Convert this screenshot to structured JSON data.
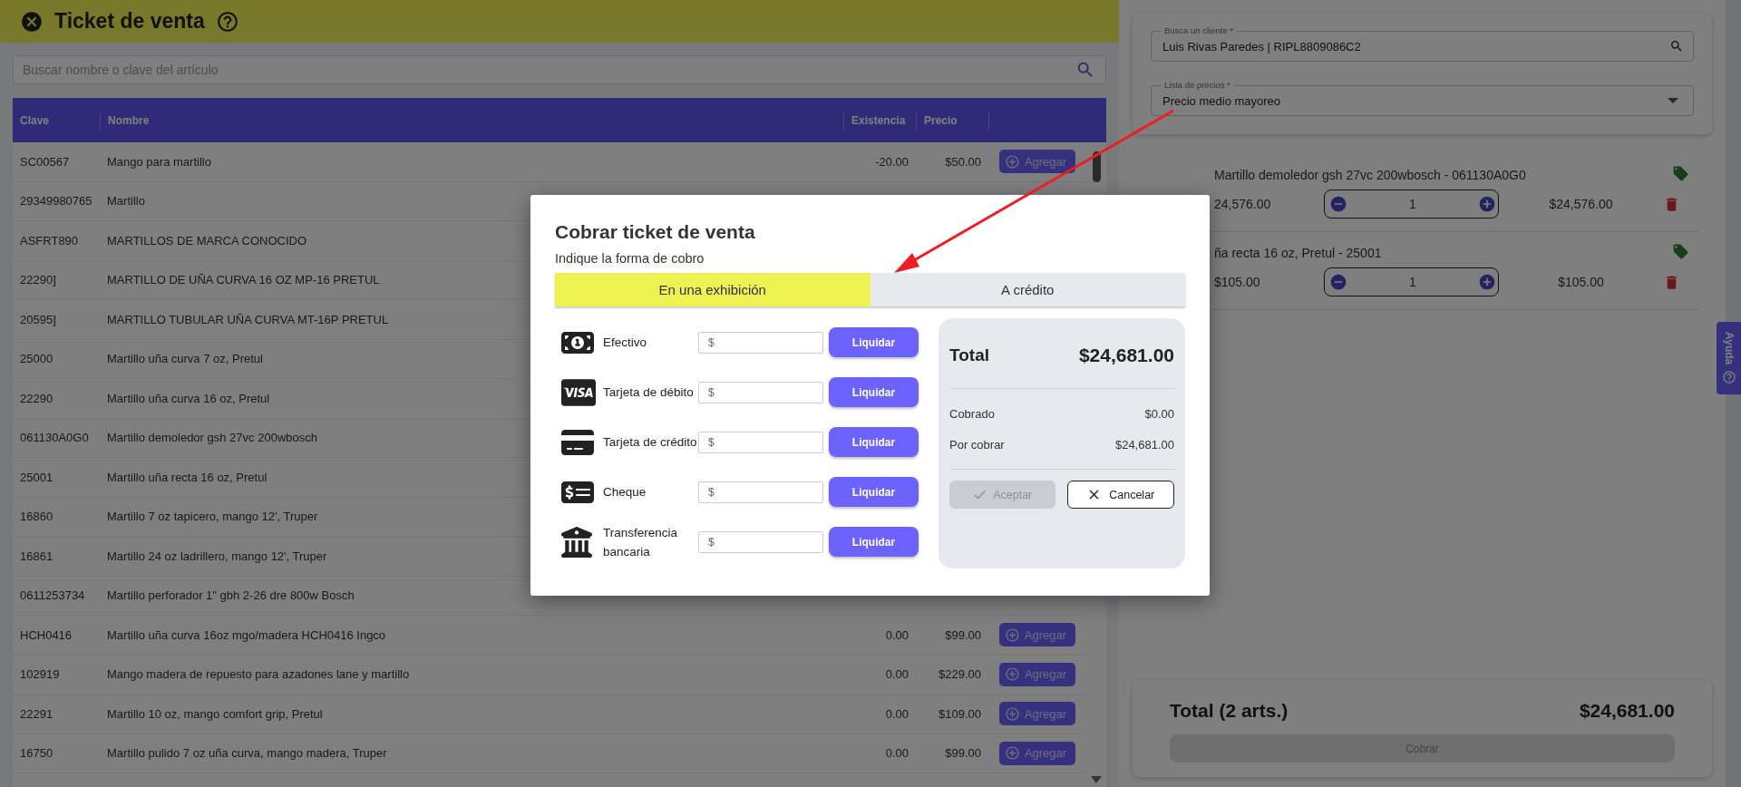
{
  "header": {
    "title": "Ticket de venta"
  },
  "search": {
    "placeholder": "Buscar nombre o clave del artículo"
  },
  "table": {
    "columns": [
      "Clave",
      "Nombre",
      "Existencia",
      "Precio"
    ],
    "rows": [
      {
        "clave": "SC00567",
        "nombre": "Mango para martillo",
        "existencia": "-20.00",
        "precio": "$50.00",
        "action": "Agregar"
      },
      {
        "clave": "29349980765",
        "nombre": "Martillo"
      },
      {
        "clave": "ASFRT890",
        "nombre": "MARTILLOS DE MARCA CONOCIDO"
      },
      {
        "clave": "22290]",
        "nombre": "MARTILLO DE UÑA CURVA 16 OZ MP-16 PRETUL"
      },
      {
        "clave": "20595]",
        "nombre": "MARTILLO TUBULAR UÑA CURVA MT-16P PRETUL"
      },
      {
        "clave": "25000",
        "nombre": "Martillo uña curva 7 oz, Pretul"
      },
      {
        "clave": "22290",
        "nombre": "Martillo uña curva 16 oz, Pretul"
      },
      {
        "clave": "061130A0G0",
        "nombre": "Martillo demoledor gsh 27vc 200wbosch"
      },
      {
        "clave": "25001",
        "nombre": "Martillo uña recta 16 oz, Pretul"
      },
      {
        "clave": "16860",
        "nombre": "Martillo 7 oz tapicero, mango 12', Truper"
      },
      {
        "clave": "16861",
        "nombre": "Martillo 24 oz ladrillero, mango 12', Truper"
      },
      {
        "clave": "0611253734",
        "nombre": "Martillo perforador 1\" gbh 2-26 dre 800w Bosch"
      },
      {
        "clave": "HCH0416",
        "nombre": "Martillo uña curva 16oz mgo/madera HCH0416 Ingco",
        "existencia": "0.00",
        "precio": "$99.00",
        "action": "Agregar"
      },
      {
        "clave": "102919",
        "nombre": "Mango madera de repuesto para azadones lane y martillo",
        "existencia": "0.00",
        "precio": "$229.00",
        "action": "Agregar"
      },
      {
        "clave": "22291",
        "nombre": "Martillo 10 oz, mango comfort grip, Pretul",
        "existencia": "0.00",
        "precio": "$109.00",
        "action": "Agregar"
      },
      {
        "clave": "16750",
        "nombre": "Martillo pulido 7 oz uña curva, mango madera, Truper",
        "existencia": "0.00",
        "precio": "$99.00",
        "action": "Agregar"
      }
    ]
  },
  "client_search": {
    "label": "Busca un cliente *",
    "value": "Luis Rivas Paredes | RIPL8809086C2"
  },
  "price_list": {
    "label": "Lista de precios *",
    "value": "Precio medio mayoreo"
  },
  "cart": [
    {
      "name": "Martillo demoledor gsh 27vc 200wbosch - 061130A0G0",
      "unit_price": "24,576.00",
      "quantity": "1",
      "line_total": "$24,576.00"
    },
    {
      "name": "ña recta 16 oz, Pretul - 25001",
      "unit_price": "$105.00",
      "quantity": "1",
      "line_total": "$105.00"
    }
  ],
  "help_tab": {
    "label": "Ayuda"
  },
  "footer": {
    "label": "Total (2 arts.)",
    "total": "$24,681.00",
    "button": {
      "label": "Cobrar",
      "disabled": true
    }
  },
  "modal": {
    "title": "Cobrar ticket de venta",
    "subtitle": "Indique la forma de cobro",
    "tabs": [
      {
        "label": "En una exhibición",
        "selected": true
      },
      {
        "label": "A crédito",
        "selected": false
      }
    ],
    "methods": [
      {
        "kind": "cash",
        "label": "Efectivo",
        "prefix": "$",
        "button": "Liquidar"
      },
      {
        "kind": "debit",
        "label": "Tarjeta de débito",
        "prefix": "$",
        "button": "Liquidar"
      },
      {
        "kind": "credit",
        "label": "Tarjeta de crédito",
        "prefix": "$",
        "button": "Liquidar"
      },
      {
        "kind": "cheque",
        "label": "Cheque",
        "prefix": "$",
        "button": "Liquidar"
      },
      {
        "kind": "transfer",
        "label": "Transferencia bancaria",
        "prefix": "$",
        "button": "Liquidar"
      }
    ],
    "summary": {
      "total_label": "Total",
      "total": "$24,681.00",
      "rows": [
        {
          "label": "Cobrado",
          "value": "$0.00"
        },
        {
          "label": "Por cobrar",
          "value": "$24,681.00"
        }
      ],
      "accept": {
        "label": "Aceptar",
        "disabled": true
      },
      "cancel": {
        "label": "Cancelar"
      }
    }
  }
}
